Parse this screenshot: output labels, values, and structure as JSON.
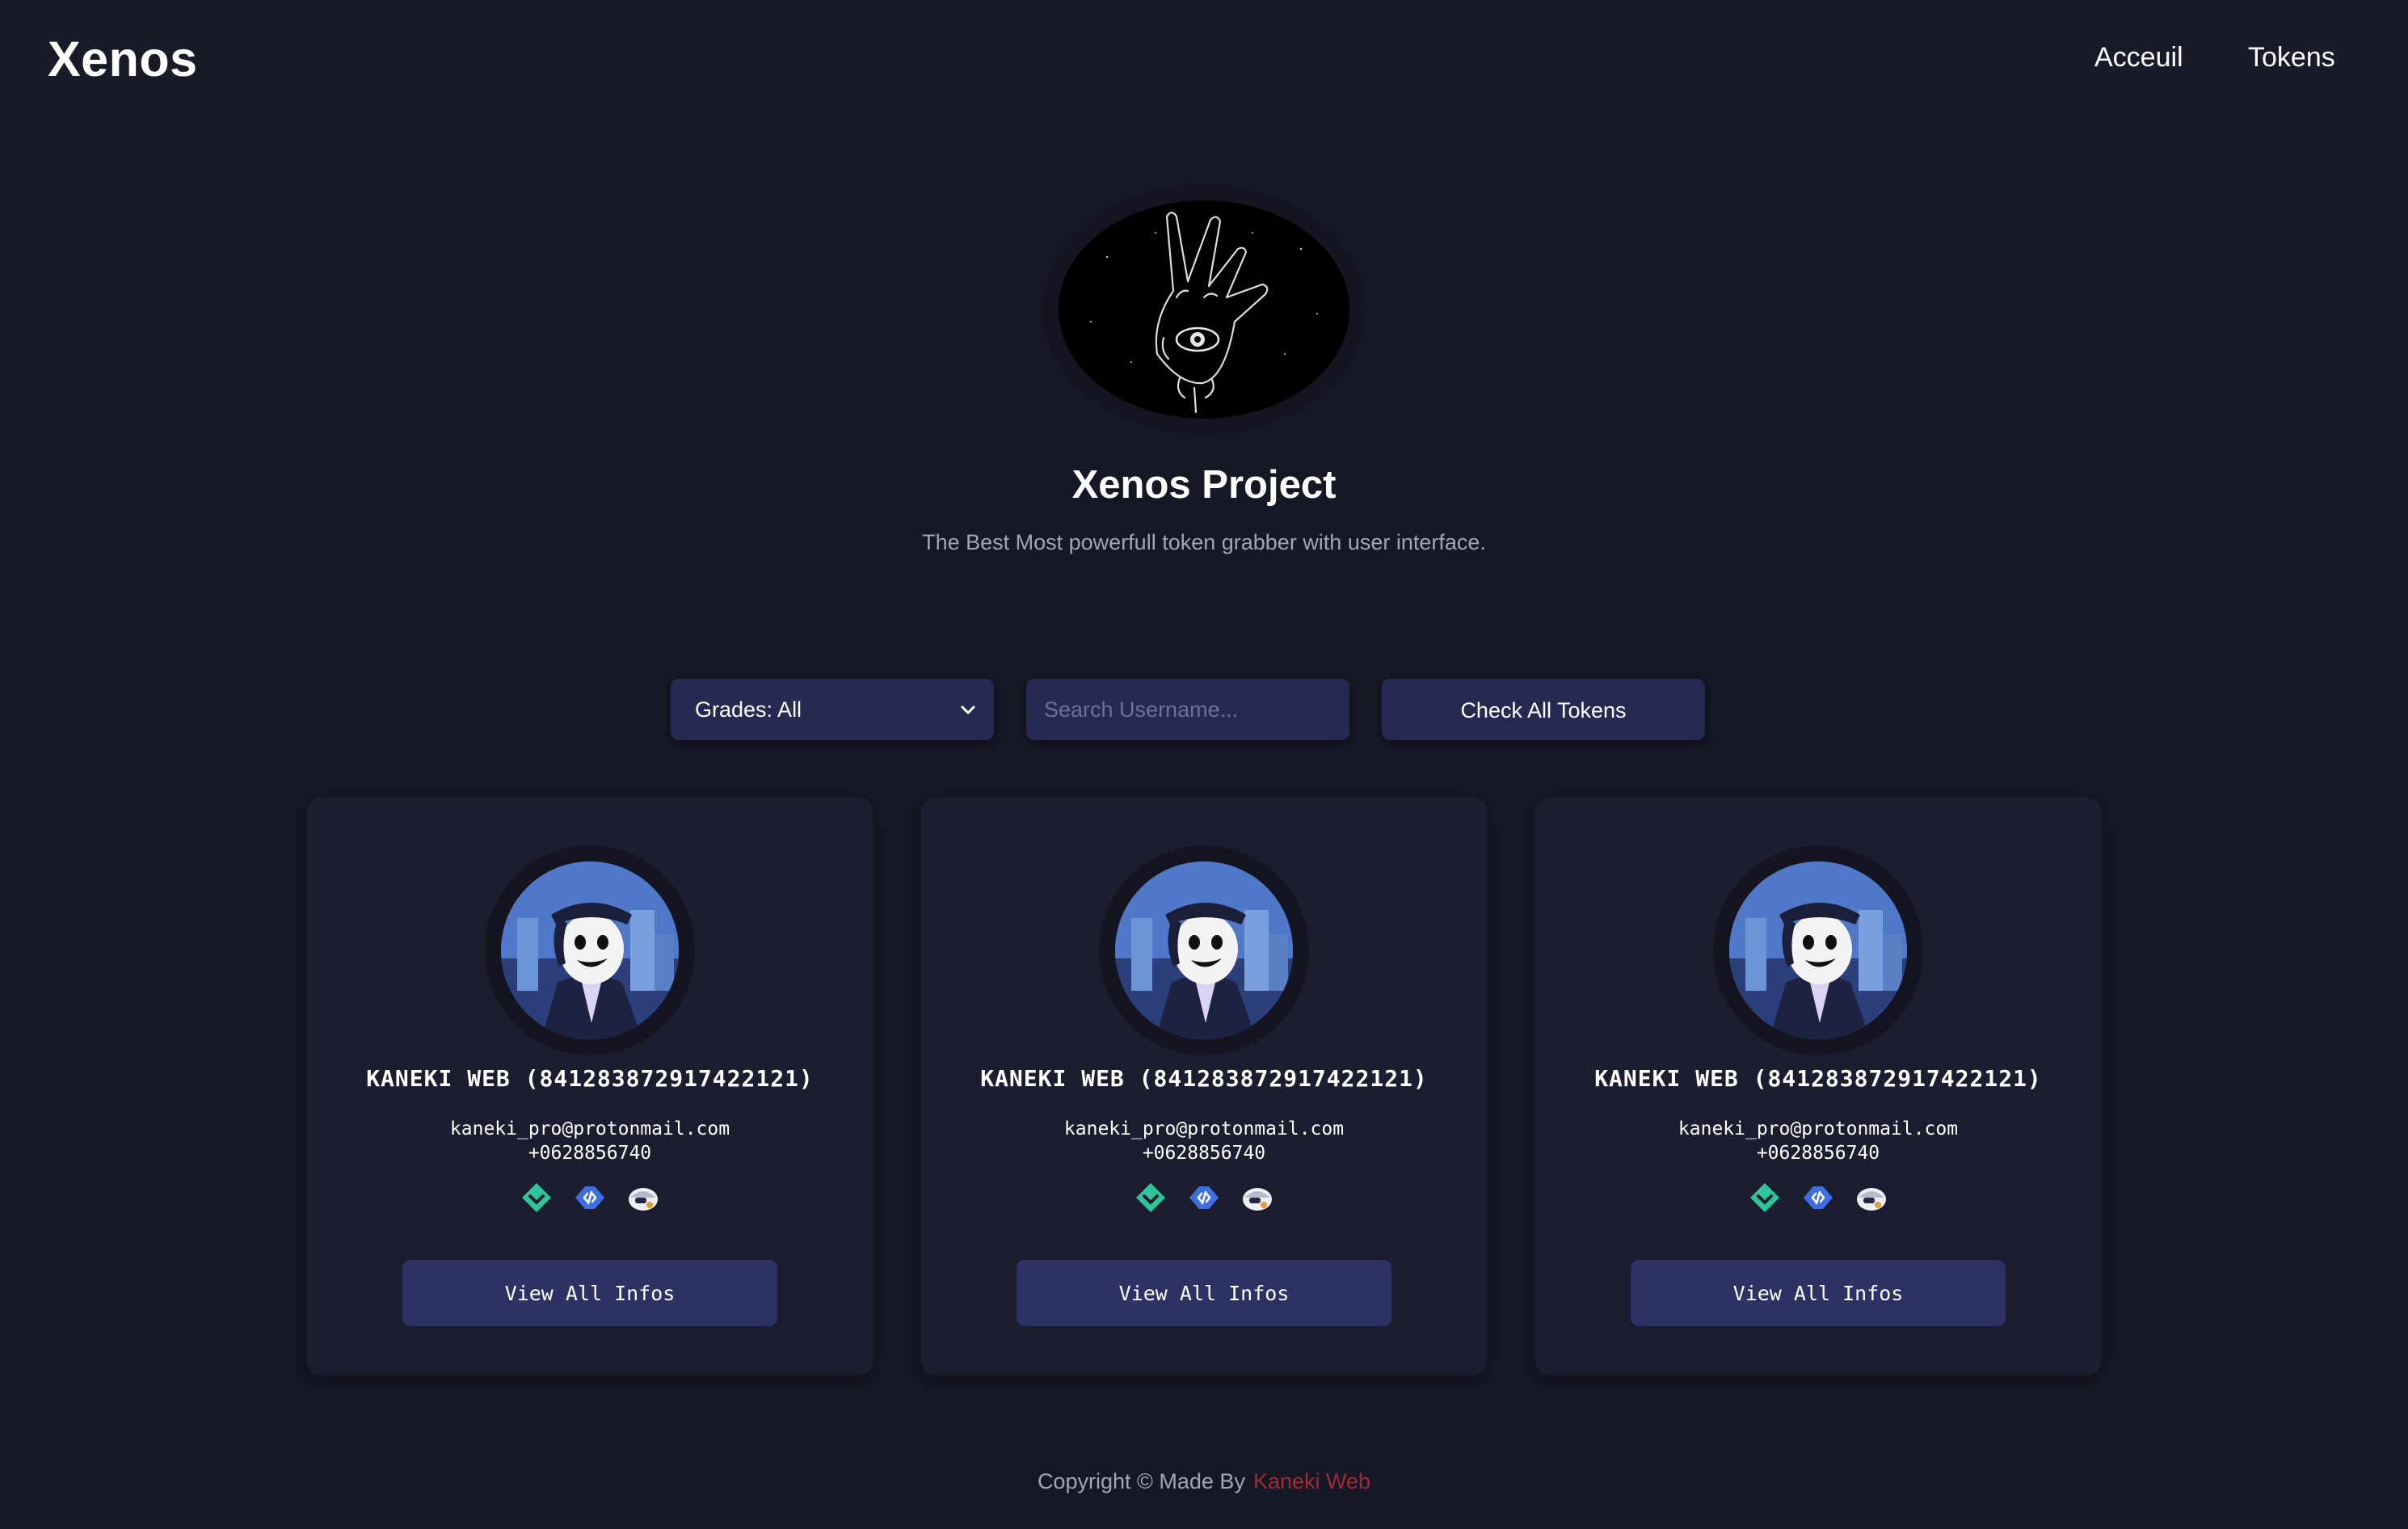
{
  "header": {
    "brand": "Xenos",
    "nav": [
      {
        "label": "Acceuil"
      },
      {
        "label": "Tokens"
      }
    ]
  },
  "hero": {
    "logo_icon": "hand-eye-icon",
    "title": "Xenos Project",
    "subtitle": "The Best Most powerfull token grabber with user interface."
  },
  "controls": {
    "grade_filter": {
      "selected": "Grades: All"
    },
    "search": {
      "placeholder": "Search Username...",
      "value": ""
    },
    "check_button": "Check All Tokens"
  },
  "cards": [
    {
      "name": "KANEKI WEB (841283872917422121)",
      "email": "kaneki_pro@protonmail.com",
      "phone": "+0628856740",
      "badges": [
        "active-developer-badge",
        "developer-badge",
        "quest-badge"
      ],
      "button": "View All Infos"
    },
    {
      "name": "KANEKI WEB (841283872917422121)",
      "email": "kaneki_pro@protonmail.com",
      "phone": "+0628856740",
      "badges": [
        "active-developer-badge",
        "developer-badge",
        "quest-badge"
      ],
      "button": "View All Infos"
    },
    {
      "name": "KANEKI WEB (841283872917422121)",
      "email": "kaneki_pro@protonmail.com",
      "phone": "+0628856740",
      "badges": [
        "active-developer-badge",
        "developer-badge",
        "quest-badge"
      ],
      "button": "View All Infos"
    }
  ],
  "footer": {
    "text": "Copyright © Made By",
    "author": "Kaneki Web"
  },
  "colors": {
    "background": "#171826",
    "card": "#1c1e2f",
    "control": "#262a52",
    "button": "#2d3163",
    "author_accent": "#a02a36"
  }
}
